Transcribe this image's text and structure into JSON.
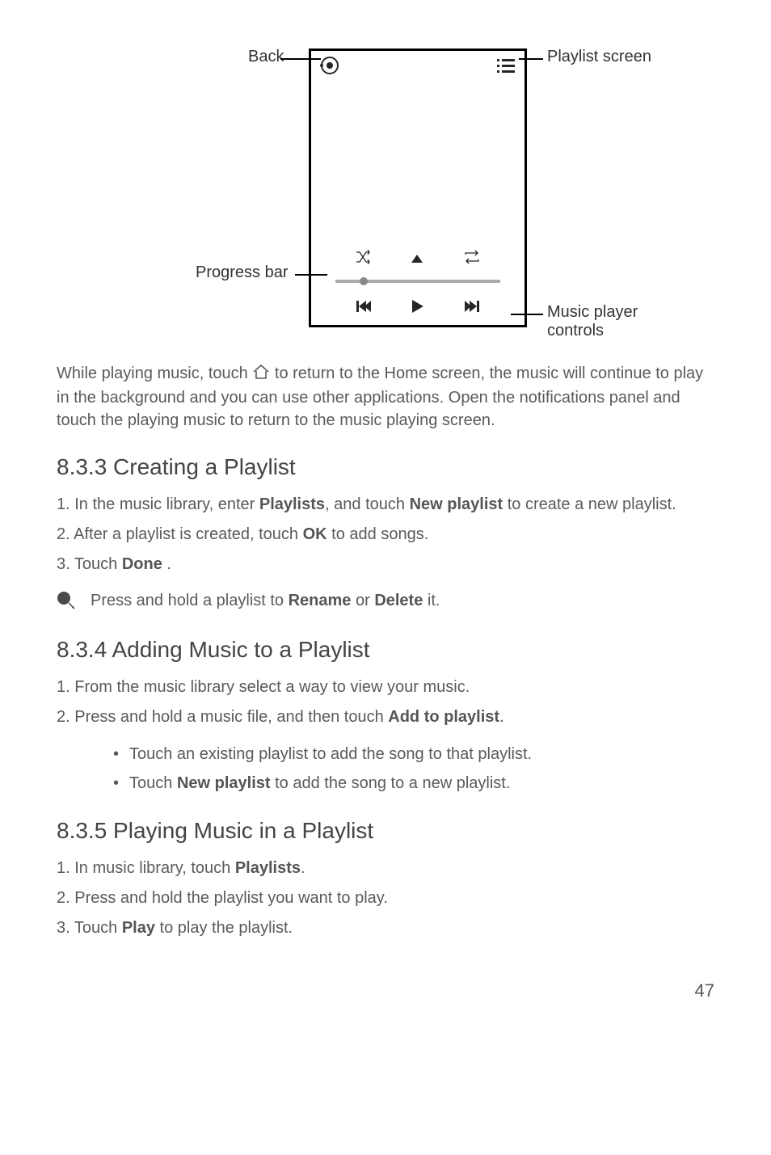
{
  "diagram": {
    "labels": {
      "back": "Back",
      "playlist_screen": "Playlist screen",
      "progress_bar": "Progress bar",
      "music_player_controls": "Music player controls"
    }
  },
  "para_while_playing": {
    "pre": "While playing music, touch ",
    "post": " to return to the Home screen, the music will continue to play in the background and you can use other applications. Open the notifications panel and touch the playing music to return to the music playing screen."
  },
  "sections": {
    "s833": {
      "title": "8.3.3  Creating a Playlist",
      "steps": {
        "s1": {
          "pre": "In the music library, enter ",
          "b1": "Playlists",
          "mid": ", and touch ",
          "b2": "New playlist",
          "post": " to create a new playlist."
        },
        "s2": {
          "pre": "After a playlist is created, touch ",
          "b1": "OK",
          "post": " to add songs."
        },
        "s3": {
          "pre": "Touch ",
          "b1": "Done",
          "post": " ."
        }
      },
      "tip": {
        "pre": "Press and hold a playlist to ",
        "b1": "Rename",
        "mid": " or ",
        "b2": "Delete",
        "post": " it."
      }
    },
    "s834": {
      "title": "8.3.4  Adding Music to a Playlist",
      "steps": {
        "s1": "From the music library select a way to view your music.",
        "s2": {
          "pre": "Press and hold a music file, and then touch ",
          "b1": "Add to playlist",
          "post": "."
        }
      },
      "sub": {
        "a": "Touch an existing playlist to add the song to that playlist.",
        "b": {
          "pre": "Touch ",
          "b1": "New playlist",
          "post": " to add the song to a new playlist."
        }
      }
    },
    "s835": {
      "title": "8.3.5  Playing Music in a Playlist",
      "steps": {
        "s1": {
          "pre": "In music library, touch ",
          "b1": "Playlists",
          "post": "."
        },
        "s2": "Press and hold the playlist you want to play.",
        "s3": {
          "pre": "Touch ",
          "b1": "Play",
          "post": " to play the playlist."
        }
      }
    }
  },
  "page_number": "47"
}
